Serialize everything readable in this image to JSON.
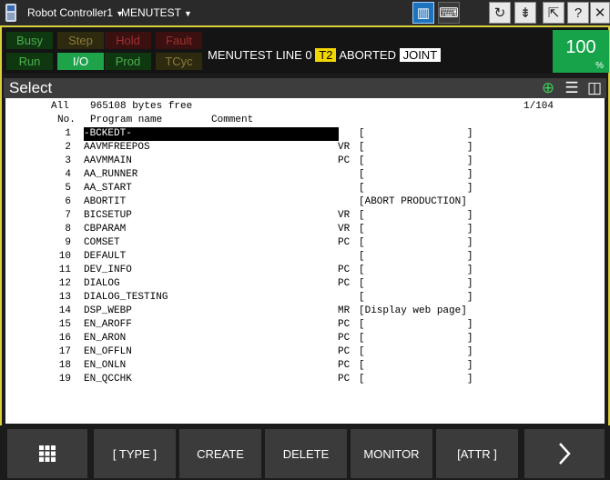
{
  "topbar": {
    "controller": "Robot Controller1",
    "program": "MENUTEST"
  },
  "status": {
    "leds": [
      {
        "label": "Busy",
        "color": "#4caf50",
        "bg": "#103810"
      },
      {
        "label": "Step",
        "color": "#8a7a3a",
        "bg": "#2e2a10"
      },
      {
        "label": "Hold",
        "color": "#a03030",
        "bg": "#3a1010"
      },
      {
        "label": "Fault",
        "color": "#a03030",
        "bg": "#3a1010"
      },
      {
        "label": "Run",
        "color": "#4caf50",
        "bg": "#103810"
      },
      {
        "label": "I/O",
        "color": "#ffffff",
        "bg": "#1ea34a"
      },
      {
        "label": "Prod",
        "color": "#4caf50",
        "bg": "#103810"
      },
      {
        "label": "TCyc",
        "color": "#8a7a3a",
        "bg": "#2e2a10"
      }
    ],
    "program": "MENUTEST",
    "line": "LINE 0",
    "mode": "T2",
    "state": "ABORTED",
    "coord": "JOINT",
    "override": "100",
    "override_unit": "%"
  },
  "header": {
    "title": "Select"
  },
  "list": {
    "filter": "All",
    "memory": "965108 bytes free",
    "page": "1/104",
    "col_no": "No.",
    "col_name": "Program name",
    "col_comment": "Comment",
    "rows": [
      {
        "no": "1",
        "name": "-BCKEDT-",
        "type": "",
        "comment": "[                 ]",
        "selected": true
      },
      {
        "no": "2",
        "name": "AAVMFREEPOS",
        "type": "VR",
        "comment": "[                 ]"
      },
      {
        "no": "3",
        "name": "AAVMMAIN",
        "type": "PC",
        "comment": "[                 ]"
      },
      {
        "no": "4",
        "name": "AA_RUNNER",
        "type": "",
        "comment": "[                 ]"
      },
      {
        "no": "5",
        "name": "AA_START",
        "type": "",
        "comment": "[                 ]"
      },
      {
        "no": "6",
        "name": "ABORTIT",
        "type": "",
        "comment": "[ABORT PRODUCTION]"
      },
      {
        "no": "7",
        "name": "BICSETUP",
        "type": "VR",
        "comment": "[                 ]"
      },
      {
        "no": "8",
        "name": "CBPARAM",
        "type": "VR",
        "comment": "[                 ]"
      },
      {
        "no": "9",
        "name": "COMSET",
        "type": "PC",
        "comment": "[                 ]"
      },
      {
        "no": "10",
        "name": "DEFAULT",
        "type": "",
        "comment": "[                 ]"
      },
      {
        "no": "11",
        "name": "DEV_INFO",
        "type": "PC",
        "comment": "[                 ]"
      },
      {
        "no": "12",
        "name": "DIALOG",
        "type": "PC",
        "comment": "[                 ]"
      },
      {
        "no": "13",
        "name": "DIALOG_TESTING",
        "type": "",
        "comment": "[                 ]"
      },
      {
        "no": "14",
        "name": "DSP_WEBP",
        "type": "MR",
        "comment": "[Display web page]"
      },
      {
        "no": "15",
        "name": "EN_AROFF",
        "type": "PC",
        "comment": "[                 ]"
      },
      {
        "no": "16",
        "name": "EN_ARON",
        "type": "PC",
        "comment": "[                 ]"
      },
      {
        "no": "17",
        "name": "EN_OFFLN",
        "type": "PC",
        "comment": "[                 ]"
      },
      {
        "no": "18",
        "name": "EN_ONLN",
        "type": "PC",
        "comment": "[                 ]"
      },
      {
        "no": "19",
        "name": "EN_QCCHK",
        "type": "PC",
        "comment": "[                 ]"
      }
    ]
  },
  "softkeys": {
    "type": "[ TYPE ]",
    "create": "CREATE",
    "delete": "DELETE",
    "monitor": "MONITOR",
    "attr": "[ATTR ]",
    "grid_icon": "grid-icon",
    "next_icon": "chevron-right-icon"
  }
}
